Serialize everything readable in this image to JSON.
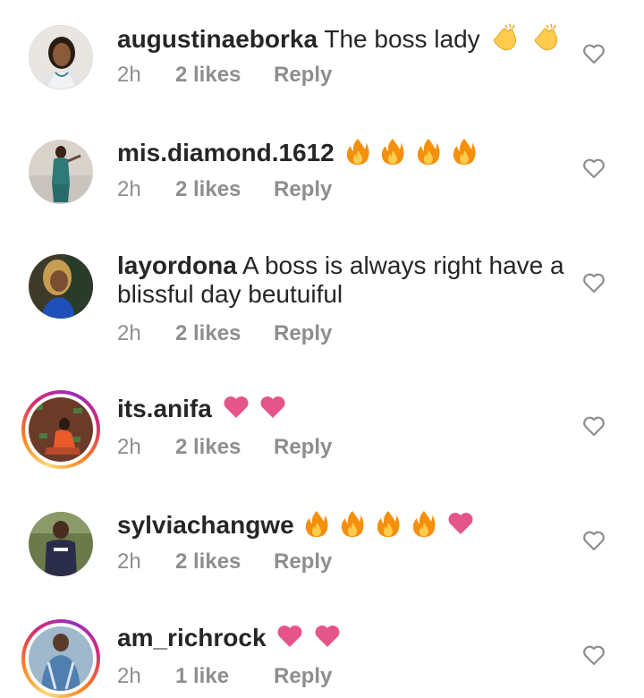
{
  "comments": [
    {
      "username": "augustinaeborka",
      "text": "The boss lady",
      "emojis": [
        "clap",
        "clap"
      ],
      "time": "2h",
      "likes": "2 likes",
      "reply": "Reply"
    },
    {
      "username": "mis.diamond.1612",
      "text": "",
      "emojis": [
        "fire",
        "fire",
        "fire",
        "fire"
      ],
      "time": "2h",
      "likes": "2 likes",
      "reply": "Reply"
    },
    {
      "username": "layordona",
      "text": "A boss is always right have a blissful day beutuiful",
      "emojis": [],
      "time": "2h",
      "likes": "2 likes",
      "reply": "Reply"
    },
    {
      "username": "its.anifa",
      "text": "",
      "emojis": [
        "pink-heart",
        "pink-heart"
      ],
      "time": "2h",
      "likes": "2 likes",
      "reply": "Reply",
      "has_story": true
    },
    {
      "username": "sylviachangwe",
      "text": "",
      "emojis": [
        "fire",
        "fire",
        "fire",
        "fire",
        "pink-heart"
      ],
      "time": "2h",
      "likes": "2 likes",
      "reply": "Reply"
    },
    {
      "username": "am_richrock",
      "text": "",
      "emojis": [
        "pink-heart",
        "pink-heart"
      ],
      "time": "2h",
      "likes": "1 like",
      "reply": "Reply",
      "has_story": true
    }
  ],
  "colors": {
    "text": "#262626",
    "meta": "#8e8e8e",
    "heart_outline": "#8e8e8e",
    "pink_heart": "#e5558a",
    "fire": "#f4900c",
    "clap": "#ffcc4d"
  },
  "icons": {
    "like": "heart-outline-icon"
  }
}
